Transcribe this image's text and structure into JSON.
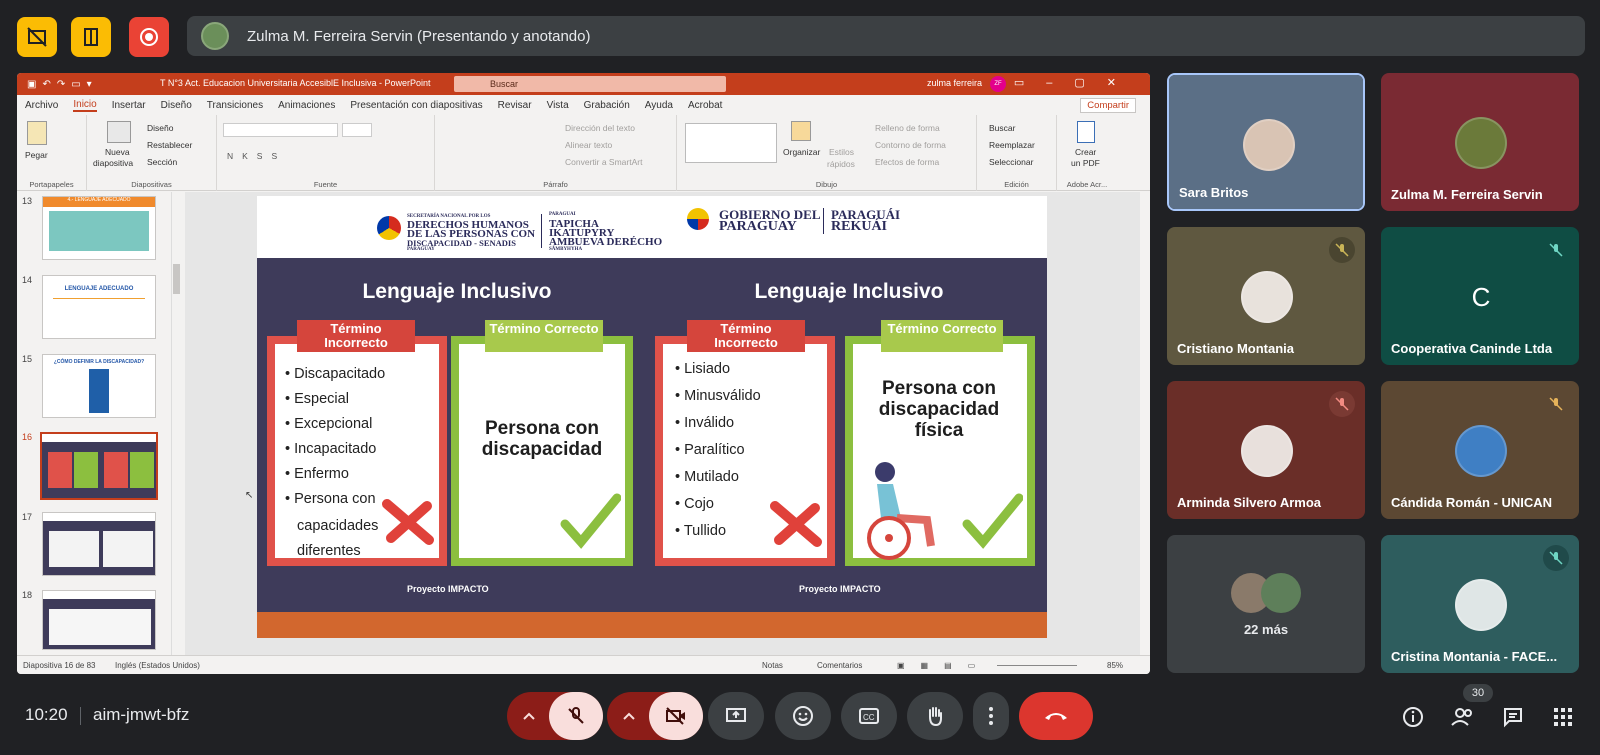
{
  "presenter": {
    "label": "Zulma M. Ferreira Servin (Presentando y anotando)"
  },
  "ppt": {
    "doc_title": "T N°3 Act. Educacion Universitaria AccesiblE Inclusiva  -  PowerPoint",
    "search_placeholder": "Buscar",
    "user": "zulma ferreira",
    "initials": "ZF",
    "menu": [
      "Archivo",
      "Inicio",
      "Insertar",
      "Diseño",
      "Transiciones",
      "Animaciones",
      "Presentación con diapositivas",
      "Revisar",
      "Vista",
      "Grabación",
      "Ayuda",
      "Acrobat"
    ],
    "share": "Compartir",
    "ribbon": {
      "pegar": "Pegar",
      "portapapeles": "Portapapeles",
      "nueva": "Nueva",
      "diapositiva": "diapositiva",
      "diseno": "Diseño",
      "restablecer": "Restablecer",
      "seccion": "Sección",
      "diapositivas": "Diapositivas",
      "fuente": "Fuente",
      "direccion": "Dirección del texto",
      "alinear": "Alinear texto",
      "convertir": "Convertir a SmartArt",
      "parrafo": "Párrafo",
      "organizar": "Organizar",
      "estilos": "Estilos",
      "rapidos": "rápidos",
      "relleno": "Relleno de forma",
      "contorno": "Contorno de forma",
      "efectos": "Efectos de forma",
      "dibujo": "Dibujo",
      "buscar": "Buscar",
      "reemplazar": "Reemplazar",
      "seleccionar": "Seleccionar",
      "edicion": "Edición",
      "crear": "Crear",
      "enpdf": "un PDF",
      "adobe": "Adobe Acr..."
    },
    "thumb_numbers": [
      "13",
      "14",
      "15",
      "16",
      "17",
      "18"
    ],
    "thumb_texts": [
      "4.- LENGUAJE ADECUADO",
      "LENGUAJE ADECUADO",
      "¿CÓMO DEFINIR LA DISCAPACIDAD?"
    ],
    "status": {
      "slide": "Diapositiva 16 de 83",
      "lang": "Inglés (Estados Unidos)",
      "notas": "Notas",
      "comentarios": "Comentarios",
      "zoom": "85%"
    }
  },
  "slide": {
    "logo_senadis": [
      "SECRETARÍA NACIONAL POR LOS",
      "DERECHOS HUMANOS",
      "DE LAS PERSONAS CON",
      "DISCAPACIDAD - SENADIS",
      "PARAGUAY"
    ],
    "logo_tapicha": [
      "PARAGUAI",
      "TAPICHA",
      "IKATUPYRY",
      "AMBUEVA DERÉCHO",
      "SÃMBYHYHA"
    ],
    "logo_gobierno": [
      "GOBIERNO DEL",
      "PARAGUAY"
    ],
    "logo_rekuai": [
      "PARAGUÁI",
      "REKUÁI"
    ],
    "title_left": "Lenguaje Inclusivo",
    "title_right": "Lenguaje Inclusivo",
    "tag_incorrect": "Término Incorrecto",
    "tag_correct": "Término Correcto",
    "left_incorrect": [
      "Discapacitado",
      "Especial",
      "Excepcional",
      "Incapacitado",
      "Enfermo",
      "Persona con",
      "capacidades",
      "diferentes"
    ],
    "left_correct": "Persona con discapacidad",
    "right_incorrect": [
      "Lisiado",
      "Minusválido",
      "Inválido",
      "Paralítico",
      "Mutilado",
      "Cojo",
      "Tullido"
    ],
    "right_correct": "Persona con discapacidad física",
    "project": "Proyecto IMPACTO"
  },
  "participants": [
    {
      "name": "Sara Britos",
      "muted": false,
      "bg": "#5b6f86"
    },
    {
      "name": "Zulma M. Ferreira Servin",
      "muted": false,
      "bg": "#7a2a33"
    },
    {
      "name": "Cristiano Montania",
      "muted": true,
      "bg": "#5f5840"
    },
    {
      "name": "Cooperativa Caninde Ltda",
      "muted": true,
      "bg": "#0f4d44",
      "initial": "C"
    },
    {
      "name": "Arminda Silvero Armoa",
      "muted": true,
      "bg": "#6a2e28"
    },
    {
      "name": "Cándida Román - UNICAN",
      "muted": true,
      "bg": "#5c4833"
    },
    {
      "name": "22 más",
      "muted": false,
      "bg": "#3c4043"
    },
    {
      "name": "Cristina Montania - FACE...",
      "muted": true,
      "bg": "#2e5d5e"
    }
  ],
  "bottom": {
    "time": "10:20",
    "meeting_code": "aim-jmwt-bfz",
    "people_count": "30"
  }
}
